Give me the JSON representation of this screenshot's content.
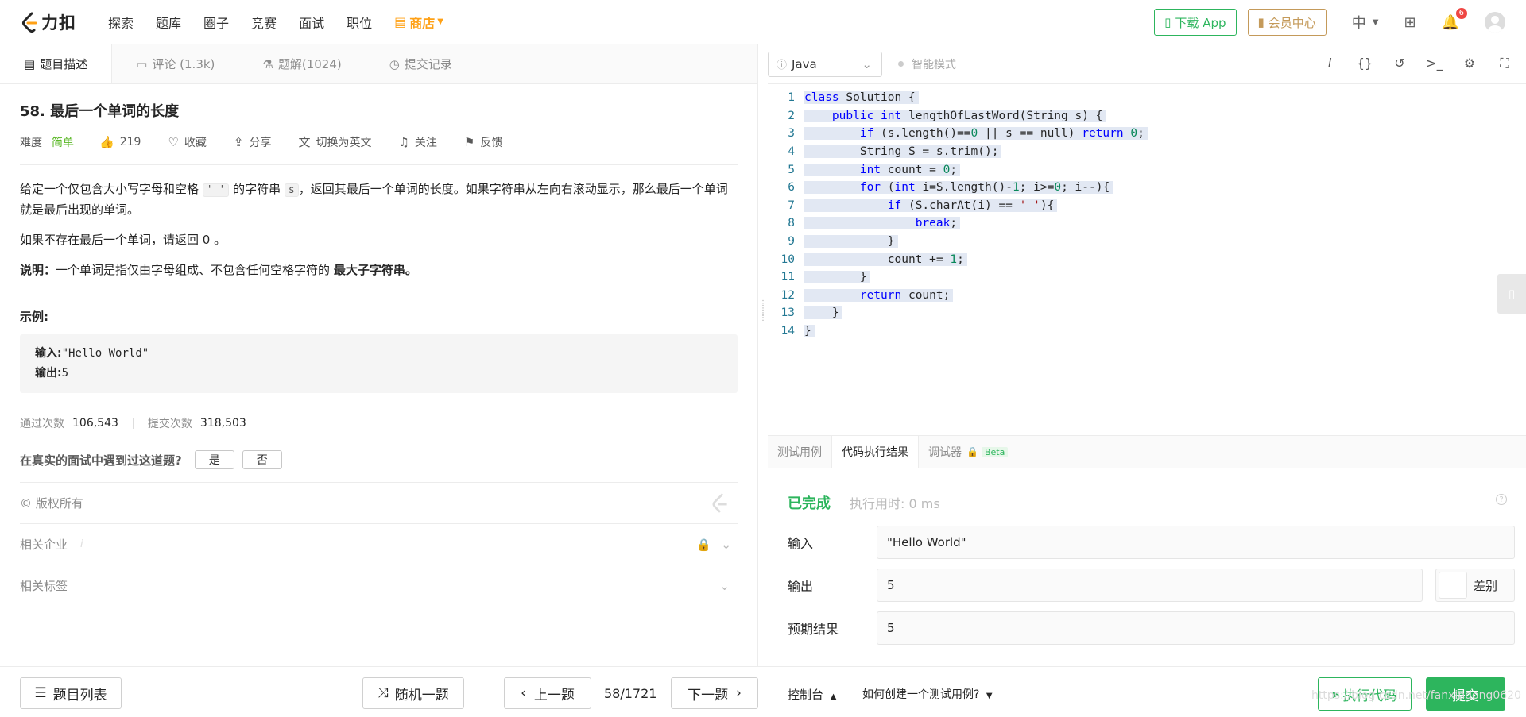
{
  "nav": {
    "logo_text": "力扣",
    "items": [
      "探索",
      "题库",
      "圈子",
      "竞赛",
      "面试",
      "职位"
    ],
    "store": "商店",
    "download_app": "下载 App",
    "member_center": "会员中心",
    "language": "中",
    "notification_count": "6"
  },
  "left_tabs": [
    {
      "label": "题目描述",
      "icon": "description-icon"
    },
    {
      "label": "评论 (1.3k)",
      "icon": "comment-icon"
    },
    {
      "label": "题解(1024)",
      "icon": "solution-icon"
    },
    {
      "label": "提交记录",
      "icon": "history-icon"
    }
  ],
  "problem": {
    "title": "58. 最后一个单词的长度",
    "difficulty_label": "难度",
    "difficulty": "简单",
    "likes": "219",
    "favorite": "收藏",
    "share": "分享",
    "switch_en": "切换为英文",
    "follow": "关注",
    "feedback": "反馈",
    "desc1_a": "给定一个仅包含大小写字母和空格",
    "desc1_code1": "' '",
    "desc1_b": "的字符串",
    "desc1_code2": "s",
    "desc1_c": "，返回其最后一个单词的长度。如果字符串从左向右滚动显示，那么最后一个单词就是最后出现的单词。",
    "desc2": "如果不存在最后一个单词，请返回 0 。",
    "note_label": "说明：",
    "note_text": "一个单词是指仅由字母组成、不包含任何空格字符的",
    "note_bold": "最大子字符串。",
    "example_title": "示例:",
    "example_input_label": "输入:",
    "example_input": "\"Hello World\"",
    "example_output_label": "输出:",
    "example_output": "5",
    "accepted_label": "通过次数",
    "accepted": "106,543",
    "submissions_label": "提交次数",
    "submissions": "318,503",
    "interview_q": "在真实的面试中遇到过这道题?",
    "yes": "是",
    "no": "否",
    "copyright": "© 版权所有",
    "companies": "相关企业",
    "tags": "相关标签"
  },
  "editor": {
    "language": "Java",
    "smart_mode": "智能模式",
    "code_lines": [
      "class Solution {",
      "    public int lengthOfLastWord(String s) {",
      "        if (s.length()==0 || s == null) return 0;",
      "        String S = s.trim();",
      "        int count = 0;",
      "        for (int i=S.length()-1; i>=0; i--){",
      "            if (S.charAt(i) == ' '){",
      "                break;",
      "            }",
      "            count += 1;",
      "        }",
      "        return count;",
      "    }",
      "}"
    ]
  },
  "console": {
    "tabs": [
      "测试用例",
      "代码执行结果",
      "调试器"
    ],
    "beta": "Beta",
    "status": "已完成",
    "exec_time": "执行用时: 0 ms",
    "input_label": "输入",
    "input_value": "\"Hello World\"",
    "output_label": "输出",
    "output_value": "5",
    "diff_label": "差别",
    "expected_label": "预期结果",
    "expected_value": "5"
  },
  "bottom": {
    "problem_list": "题目列表",
    "random": "随机一题",
    "prev": "上一题",
    "page": "58/1721",
    "next": "下一题",
    "console": "控制台",
    "how_to_test": "如何创建一个测试用例?",
    "run_code": "执行代码",
    "submit": "提交",
    "watermark": "https://blog.csdn.net/fanxindong0620"
  },
  "colors": {
    "green": "#2db55d",
    "orange": "#ffa116",
    "easy": "#5ab726"
  }
}
